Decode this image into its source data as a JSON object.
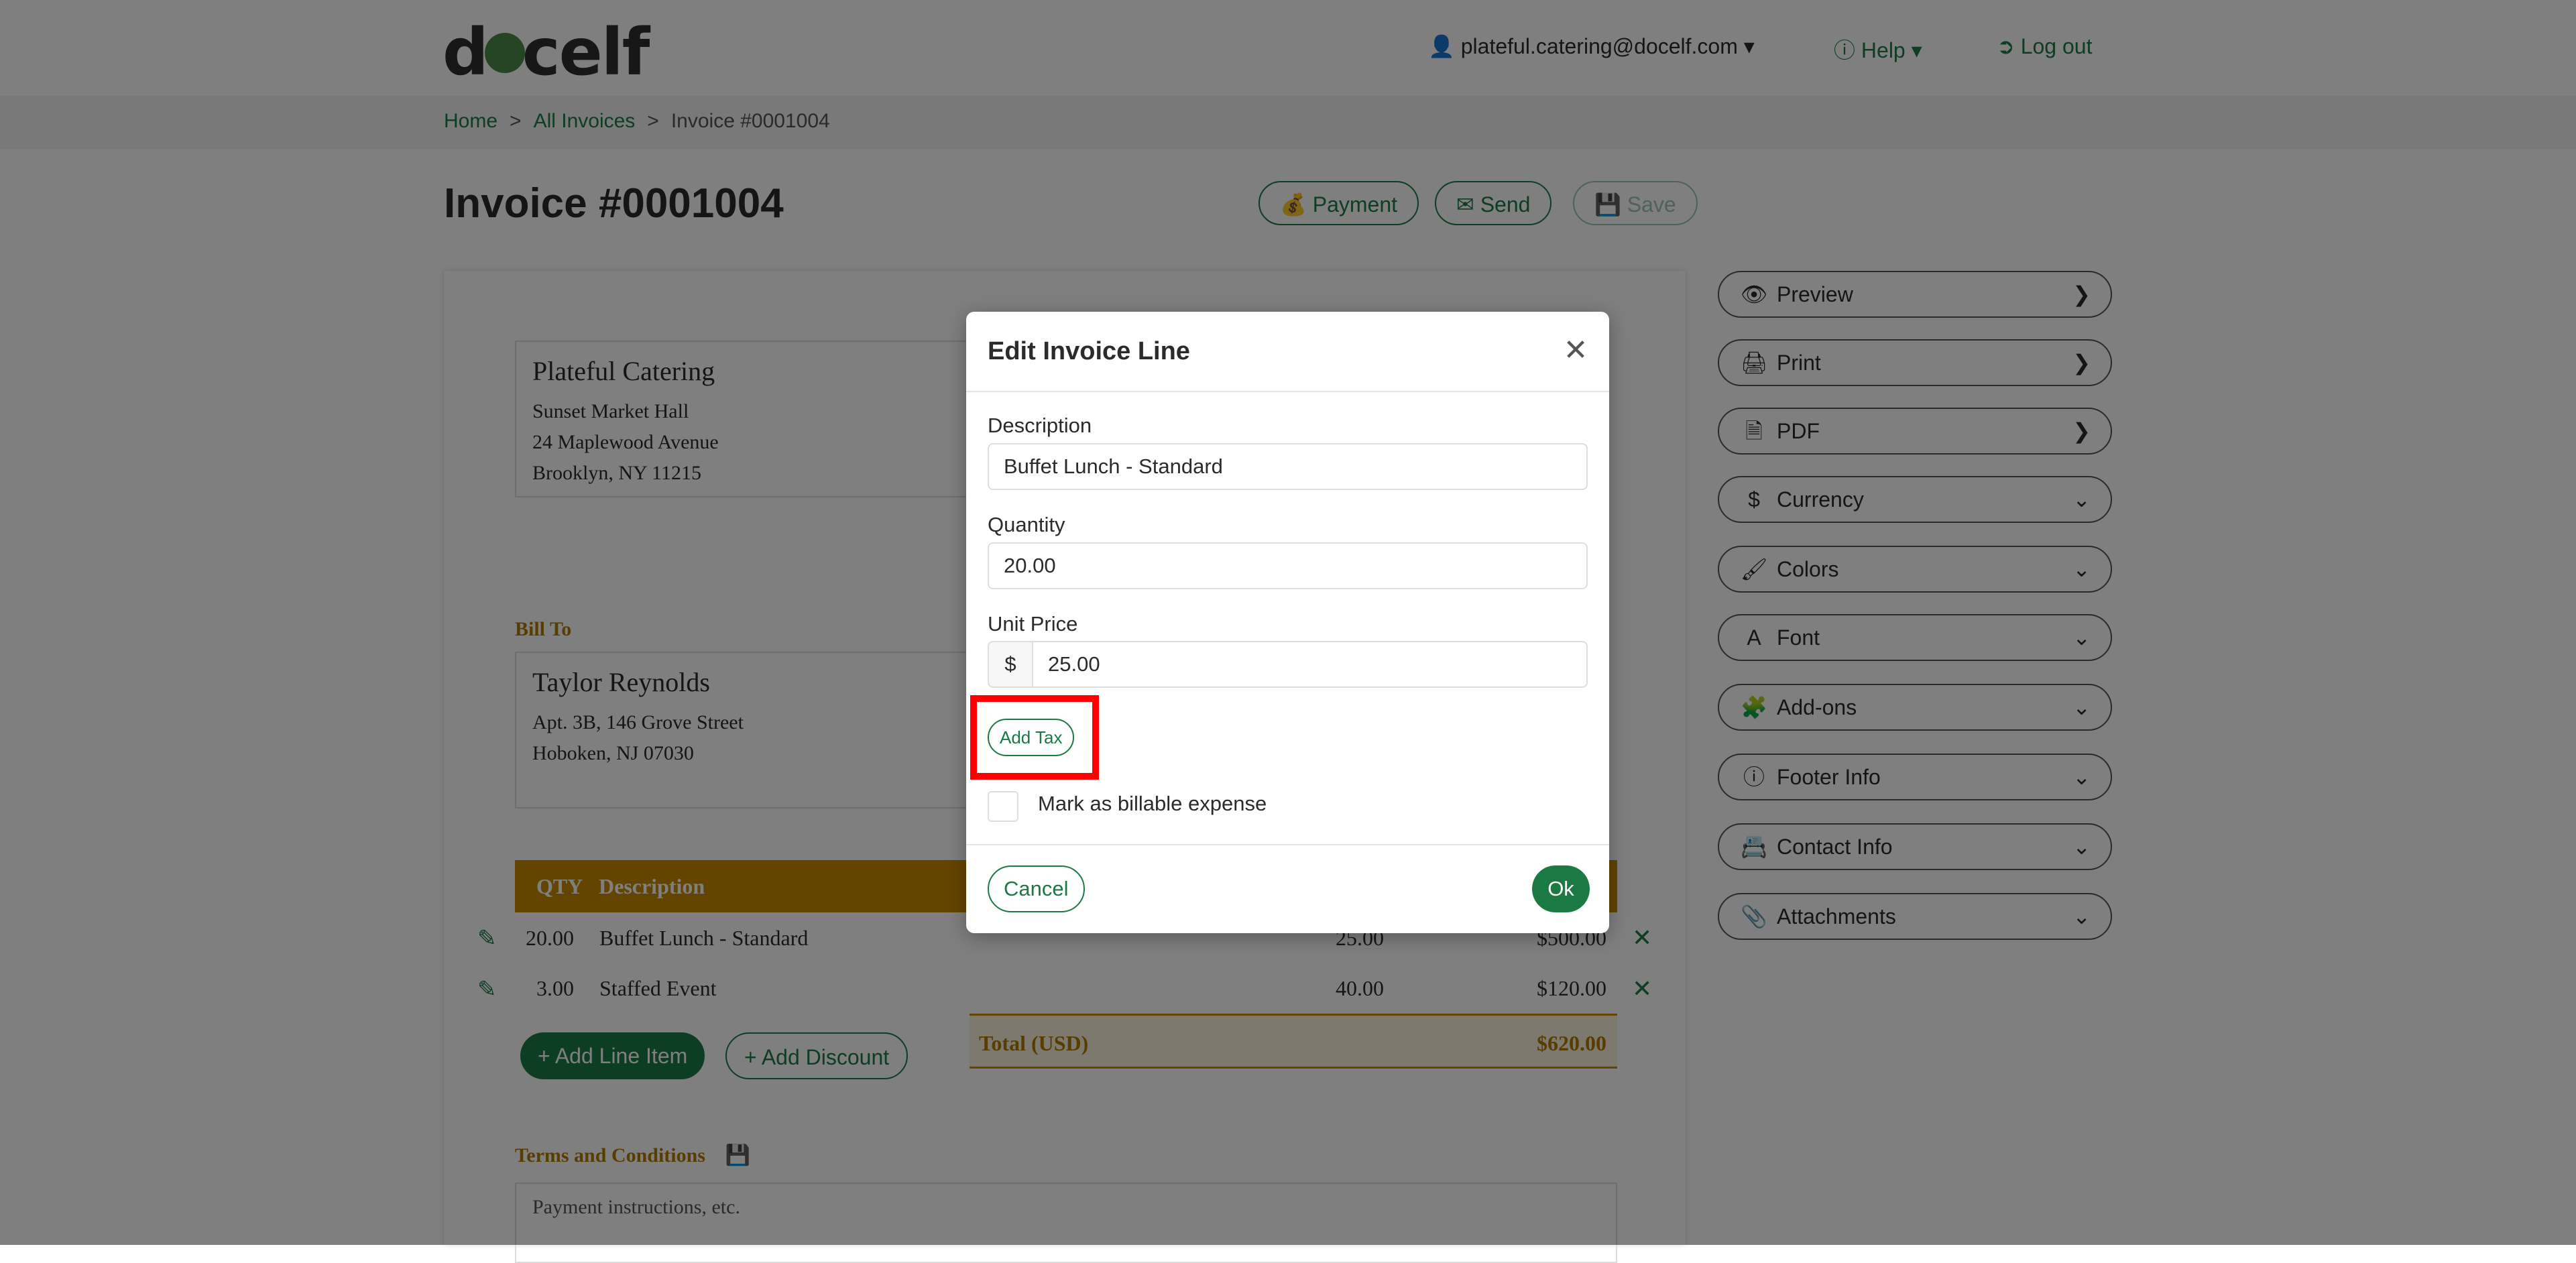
{
  "header": {
    "logo_text": "docelf",
    "user_email": "plateful.catering@docelf.com",
    "help_label": "Help",
    "logout_label": "Log out"
  },
  "breadcrumb": [
    "Home",
    "All Invoices",
    "Invoice #0001004"
  ],
  "page_title": "Invoice #0001004",
  "actions": {
    "payment": "Payment",
    "send": "Send",
    "save": "Save"
  },
  "company": {
    "name": "Plateful Catering",
    "lines": [
      "Sunset Market Hall",
      "24 Maplewood Avenue",
      "Brooklyn, NY 11215"
    ]
  },
  "bill_to": {
    "label": "Bill To",
    "name": "Taylor Reynolds",
    "lines": [
      "Apt. 3B, 146 Grove Street",
      "Hoboken, NJ 07030"
    ]
  },
  "line_table": {
    "headers": {
      "qty": "QTY",
      "description": "Description"
    },
    "rows": [
      {
        "qty": "20.00",
        "description": "Buffet Lunch - Standard",
        "unit_price": "25.00",
        "amount": "$500.00"
      },
      {
        "qty": "3.00",
        "description": "Staffed Event",
        "unit_price": "40.00",
        "amount": "$120.00"
      }
    ],
    "total_label": "Total (USD)",
    "total_value": "$620.00"
  },
  "buttons": {
    "add_line_item": "Add Line Item",
    "add_discount": "Add Discount"
  },
  "terms": {
    "label": "Terms and Conditions",
    "placeholder": "Payment instructions, etc."
  },
  "sidebar": {
    "items": [
      {
        "label": "Preview",
        "icon": "eye-icon",
        "chevron": "right"
      },
      {
        "label": "Print",
        "icon": "printer-icon",
        "chevron": "right"
      },
      {
        "label": "PDF",
        "icon": "pdf-icon",
        "chevron": "right"
      },
      {
        "label": "Currency",
        "icon": "dollar-icon",
        "chevron": "down"
      },
      {
        "label": "Colors",
        "icon": "brush-icon",
        "chevron": "down"
      },
      {
        "label": "Font",
        "icon": "font-icon",
        "chevron": "down"
      },
      {
        "label": "Add-ons",
        "icon": "puzzle-icon",
        "chevron": "down"
      },
      {
        "label": "Footer Info",
        "icon": "info-icon",
        "chevron": "down"
      },
      {
        "label": "Contact Info",
        "icon": "contact-card-icon",
        "chevron": "down"
      },
      {
        "label": "Attachments",
        "icon": "paperclip-icon",
        "chevron": "down"
      }
    ]
  },
  "modal": {
    "title": "Edit Invoice Line",
    "description_label": "Description",
    "description_value": "Buffet Lunch - Standard",
    "quantity_label": "Quantity",
    "quantity_value": "20.00",
    "unit_price_label": "Unit Price",
    "currency_symbol": "$",
    "unit_price_value": "25.00",
    "add_tax_label": "Add Tax",
    "billable_label": "Mark as billable expense",
    "cancel_label": "Cancel",
    "ok_label": "Ok"
  },
  "colors": {
    "accent_green": "#1b7a44",
    "header_gold": "#c98a00",
    "highlight_red": "#ff0000"
  }
}
